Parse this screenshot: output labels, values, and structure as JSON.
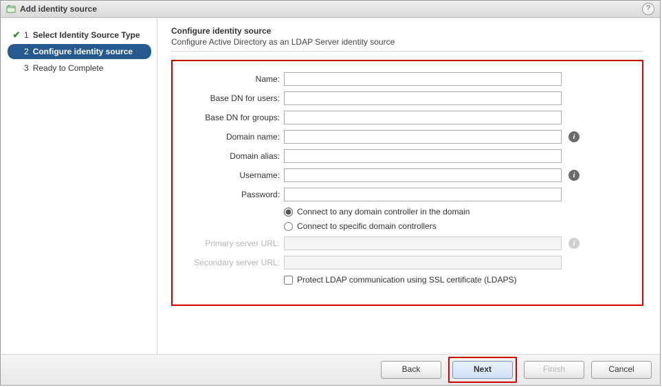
{
  "dialog": {
    "title": "Add identity source"
  },
  "wizard": {
    "steps": [
      {
        "num": "1",
        "label": "Select Identity Source Type",
        "state": "completed"
      },
      {
        "num": "2",
        "label": "Configure identity source",
        "state": "current"
      },
      {
        "num": "3",
        "label": "Ready to Complete",
        "state": "pending"
      }
    ]
  },
  "page": {
    "heading": "Configure identity source",
    "subheading": "Configure Active Directory as an LDAP Server identity source"
  },
  "form": {
    "name_label": "Name:",
    "base_dn_users_label": "Base DN for users:",
    "base_dn_groups_label": "Base DN for groups:",
    "domain_name_label": "Domain name:",
    "domain_alias_label": "Domain alias:",
    "username_label": "Username:",
    "password_label": "Password:",
    "radio_any": "Connect to any domain controller in the domain",
    "radio_specific": "Connect to specific domain controllers",
    "primary_url_label": "Primary server URL:",
    "secondary_url_label": "Secondary server URL:",
    "ldaps_label": "Protect LDAP communication using SSL certificate (LDAPS)",
    "values": {
      "name": "",
      "base_dn_users": "",
      "base_dn_groups": "",
      "domain_name": "",
      "domain_alias": "",
      "username": "",
      "password": "",
      "primary_url": "",
      "secondary_url": ""
    },
    "state": {
      "connect_mode": "any",
      "ldaps_checked": false
    }
  },
  "buttons": {
    "back": "Back",
    "next": "Next",
    "finish": "Finish",
    "cancel": "Cancel"
  }
}
